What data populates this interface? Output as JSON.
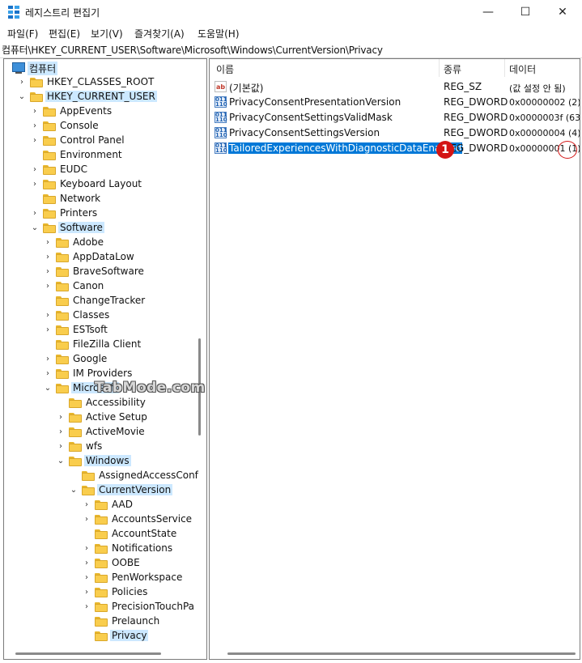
{
  "window": {
    "title": "레지스트리 편집기",
    "minimize": "—",
    "maximize": "☐",
    "close": "✕"
  },
  "menu": [
    "파일(F)",
    "편집(E)",
    "보기(V)",
    "즐겨찾기(A)",
    "도움말(H)"
  ],
  "address": "컴퓨터\\HKEY_CURRENT_USER\\Software\\Microsoft\\Windows\\CurrentVersion\\Privacy",
  "tree": [
    {
      "label": "컴퓨터",
      "level": 0,
      "chevron": "",
      "icon": "computer-icon",
      "selected": true
    },
    {
      "label": "HKEY_CLASSES_ROOT",
      "level": 1,
      "chevron": "›",
      "icon": "folder-icon"
    },
    {
      "label": "HKEY_CURRENT_USER",
      "level": 1,
      "chevron": "⌄",
      "icon": "folder-icon",
      "selected": true
    },
    {
      "label": "AppEvents",
      "level": 2,
      "chevron": "›",
      "icon": "folder-icon"
    },
    {
      "label": "Console",
      "level": 2,
      "chevron": "›",
      "icon": "folder-icon"
    },
    {
      "label": "Control Panel",
      "level": 2,
      "chevron": "›",
      "icon": "folder-icon"
    },
    {
      "label": "Environment",
      "level": 2,
      "chevron": "",
      "icon": "folder-icon"
    },
    {
      "label": "EUDC",
      "level": 2,
      "chevron": "›",
      "icon": "folder-icon"
    },
    {
      "label": "Keyboard Layout",
      "level": 2,
      "chevron": "›",
      "icon": "folder-icon"
    },
    {
      "label": "Network",
      "level": 2,
      "chevron": "",
      "icon": "folder-icon"
    },
    {
      "label": "Printers",
      "level": 2,
      "chevron": "›",
      "icon": "folder-icon"
    },
    {
      "label": "Software",
      "level": 2,
      "chevron": "⌄",
      "icon": "folder-icon",
      "selected": true
    },
    {
      "label": "Adobe",
      "level": 3,
      "chevron": "›",
      "icon": "folder-icon"
    },
    {
      "label": "AppDataLow",
      "level": 3,
      "chevron": "›",
      "icon": "folder-icon"
    },
    {
      "label": "BraveSoftware",
      "level": 3,
      "chevron": "›",
      "icon": "folder-icon"
    },
    {
      "label": "Canon",
      "level": 3,
      "chevron": "›",
      "icon": "folder-icon"
    },
    {
      "label": "ChangeTracker",
      "level": 3,
      "chevron": "",
      "icon": "folder-icon"
    },
    {
      "label": "Classes",
      "level": 3,
      "chevron": "›",
      "icon": "folder-icon"
    },
    {
      "label": "ESTsoft",
      "level": 3,
      "chevron": "›",
      "icon": "folder-icon"
    },
    {
      "label": "FileZilla Client",
      "level": 3,
      "chevron": "",
      "icon": "folder-icon"
    },
    {
      "label": "Google",
      "level": 3,
      "chevron": "›",
      "icon": "folder-icon"
    },
    {
      "label": "IM Providers",
      "level": 3,
      "chevron": "›",
      "icon": "folder-icon"
    },
    {
      "label": "Microsoft",
      "level": 3,
      "chevron": "⌄",
      "icon": "folder-icon",
      "selected": true
    },
    {
      "label": "Accessibility",
      "level": 4,
      "chevron": "",
      "icon": "folder-icon"
    },
    {
      "label": "Active Setup",
      "level": 4,
      "chevron": "›",
      "icon": "folder-icon"
    },
    {
      "label": "ActiveMovie",
      "level": 4,
      "chevron": "›",
      "icon": "folder-icon"
    },
    {
      "label": "wfs",
      "level": 4,
      "chevron": "›",
      "icon": "folder-icon"
    },
    {
      "label": "Windows",
      "level": 4,
      "chevron": "⌄",
      "icon": "folder-icon",
      "selected": true
    },
    {
      "label": "AssignedAccessConf",
      "level": 5,
      "chevron": "",
      "icon": "folder-icon"
    },
    {
      "label": "CurrentVersion",
      "level": 5,
      "chevron": "⌄",
      "icon": "folder-icon",
      "selected": true
    },
    {
      "label": "AAD",
      "level": 6,
      "chevron": "›",
      "icon": "folder-icon"
    },
    {
      "label": "AccountsService",
      "level": 6,
      "chevron": "›",
      "icon": "folder-icon"
    },
    {
      "label": "AccountState",
      "level": 6,
      "chevron": "",
      "icon": "folder-icon"
    },
    {
      "label": "Notifications",
      "level": 6,
      "chevron": "›",
      "icon": "folder-icon"
    },
    {
      "label": "OOBE",
      "level": 6,
      "chevron": "›",
      "icon": "folder-icon"
    },
    {
      "label": "PenWorkspace",
      "level": 6,
      "chevron": "›",
      "icon": "folder-icon"
    },
    {
      "label": "Policies",
      "level": 6,
      "chevron": "›",
      "icon": "folder-icon"
    },
    {
      "label": "PrecisionTouchPa",
      "level": 6,
      "chevron": "›",
      "icon": "folder-icon"
    },
    {
      "label": "Prelaunch",
      "level": 6,
      "chevron": "",
      "icon": "folder-icon"
    },
    {
      "label": "Privacy",
      "level": 6,
      "chevron": "",
      "icon": "folder-icon",
      "selected": true
    }
  ],
  "columns": {
    "name": "이름",
    "type": "종류",
    "data": "데이터"
  },
  "values": [
    {
      "icon": "string-value-icon",
      "glyph": "ab",
      "name": "(기본값)",
      "type": "REG_SZ",
      "data": "(값 설정 안 됨)"
    },
    {
      "icon": "binary-value-icon",
      "glyph": "011\n110",
      "name": "PrivacyConsentPresentationVersion",
      "type": "REG_DWORD",
      "data": "0x00000002 (2)"
    },
    {
      "icon": "binary-value-icon",
      "glyph": "011\n110",
      "name": "PrivacyConsentSettingsValidMask",
      "type": "REG_DWORD",
      "data": "0x0000003f (63)"
    },
    {
      "icon": "binary-value-icon",
      "glyph": "011\n110",
      "name": "PrivacyConsentSettingsVersion",
      "type": "REG_DWORD",
      "data": "0x00000004 (4)"
    },
    {
      "icon": "binary-value-icon",
      "glyph": "011\n110",
      "name": "TailoredExperiencesWithDiagnosticDataEnabled",
      "type": "REG_DWORD",
      "data": "0x00000001 (1)",
      "selected": true
    }
  ],
  "annotation": {
    "badge": "1"
  },
  "watermark": "TabMode.com",
  "colors": {
    "selection": "#0078d7",
    "tree_selection": "#cce8ff",
    "badge": "#d31515"
  }
}
